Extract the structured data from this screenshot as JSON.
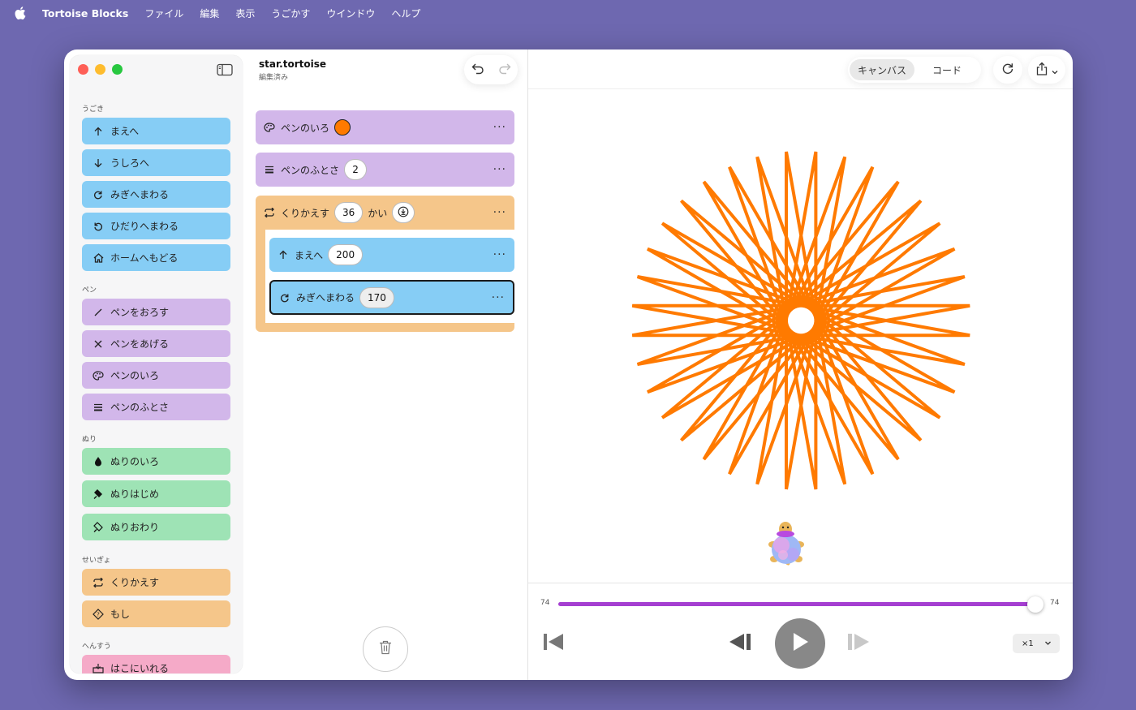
{
  "menubar": {
    "app_name": "Tortoise Blocks",
    "items": [
      "ファイル",
      "編集",
      "表示",
      "うごかす",
      "ウインドウ",
      "ヘルプ"
    ]
  },
  "sidebar": {
    "sections": {
      "motion": "うごき",
      "pen": "ペン",
      "fill": "ぬり",
      "control": "せいぎょ",
      "variables": "へんすう"
    },
    "blocks": {
      "forward": "まえへ",
      "backward": "うしろへ",
      "turn_right": "みぎへまわる",
      "turn_left": "ひだりへまわる",
      "home": "ホームへもどる",
      "pen_down": "ペンをおろす",
      "pen_up": "ペンをあげる",
      "pen_color": "ペンのいろ",
      "pen_width": "ペンのふとさ",
      "fill_color": "ぬりのいろ",
      "fill_begin": "ぬりはじめ",
      "fill_end": "ぬりおわり",
      "repeat": "くりかえす",
      "if": "もし",
      "set_var": "はこにいれる"
    }
  },
  "editor": {
    "file_name": "star.tortoise",
    "file_status": "編集済み",
    "program": {
      "pen_color_label": "ペンのいろ",
      "pen_color_value": "#ff7a00",
      "pen_width_label": "ペンのふとさ",
      "pen_width_value": "2",
      "repeat_label": "くりかえす",
      "repeat_count": "36",
      "repeat_suffix": "かい",
      "forward_label": "まえへ",
      "forward_value": "200",
      "turn_label": "みぎへまわる",
      "turn_value": "170",
      "more": "···"
    }
  },
  "canvas": {
    "tabs": [
      "キャンバス",
      "コード"
    ],
    "active_tab": "キャンバス",
    "stroke_color": "#ff7a00",
    "player": {
      "step_current": "74",
      "step_total": "74",
      "progress": 1.0,
      "speed": "×1"
    }
  }
}
